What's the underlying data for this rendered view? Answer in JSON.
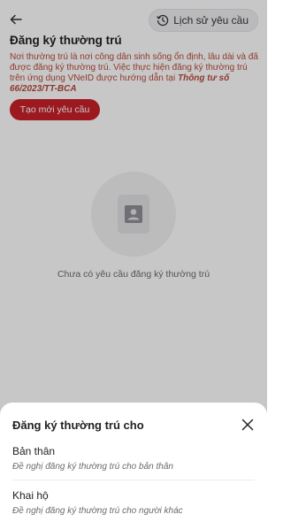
{
  "header": {
    "back_icon": "arrow-left-icon",
    "history_label": "Lịch sử yêu cầu",
    "history_icon": "clock-history-icon"
  },
  "page": {
    "title": "Đăng ký thường trú",
    "description_plain": "Nơi thường trú là nơi công dân sinh sống ổn định, lâu dài và đã được đăng ký thường trú. Việc thực hiện đăng ký thường trú trên ứng dụng VNeID được hướng dẫn tại ",
    "description_emph": "Thông tư số 66/2023/TT-BCA",
    "create_button": "Tạo mới yêu cầu",
    "empty_icon": "person-document-icon",
    "empty_text": "Chưa có yêu cầu đăng ký thường trú"
  },
  "sheet": {
    "title": "Đăng ký thường trú cho",
    "close_icon": "close-icon",
    "options": [
      {
        "title": "Bản thân",
        "subtitle": "Đề nghị đăng ký thường trú cho bản thân"
      },
      {
        "title": "Khai hộ",
        "subtitle": "Đề nghị đăng ký thường trú cho người khác"
      }
    ]
  },
  "colors": {
    "brand_red": "#c8202a",
    "description_text": "#b84a3a",
    "overlay": "rgba(0,0,0,0.22)"
  }
}
